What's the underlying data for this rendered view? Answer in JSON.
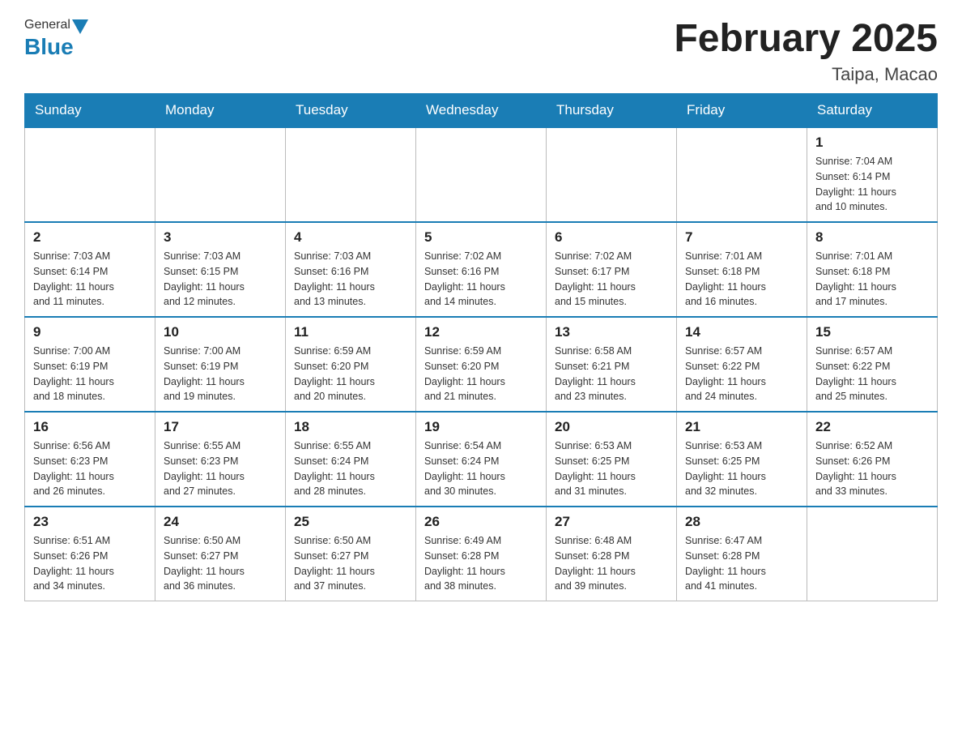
{
  "header": {
    "logo_general": "General",
    "logo_blue": "Blue",
    "main_title": "February 2025",
    "subtitle": "Taipa, Macao"
  },
  "weekdays": [
    "Sunday",
    "Monday",
    "Tuesday",
    "Wednesday",
    "Thursday",
    "Friday",
    "Saturday"
  ],
  "weeks": [
    [
      {
        "day": "",
        "info": ""
      },
      {
        "day": "",
        "info": ""
      },
      {
        "day": "",
        "info": ""
      },
      {
        "day": "",
        "info": ""
      },
      {
        "day": "",
        "info": ""
      },
      {
        "day": "",
        "info": ""
      },
      {
        "day": "1",
        "info": "Sunrise: 7:04 AM\nSunset: 6:14 PM\nDaylight: 11 hours\nand 10 minutes."
      }
    ],
    [
      {
        "day": "2",
        "info": "Sunrise: 7:03 AM\nSunset: 6:14 PM\nDaylight: 11 hours\nand 11 minutes."
      },
      {
        "day": "3",
        "info": "Sunrise: 7:03 AM\nSunset: 6:15 PM\nDaylight: 11 hours\nand 12 minutes."
      },
      {
        "day": "4",
        "info": "Sunrise: 7:03 AM\nSunset: 6:16 PM\nDaylight: 11 hours\nand 13 minutes."
      },
      {
        "day": "5",
        "info": "Sunrise: 7:02 AM\nSunset: 6:16 PM\nDaylight: 11 hours\nand 14 minutes."
      },
      {
        "day": "6",
        "info": "Sunrise: 7:02 AM\nSunset: 6:17 PM\nDaylight: 11 hours\nand 15 minutes."
      },
      {
        "day": "7",
        "info": "Sunrise: 7:01 AM\nSunset: 6:18 PM\nDaylight: 11 hours\nand 16 minutes."
      },
      {
        "day": "8",
        "info": "Sunrise: 7:01 AM\nSunset: 6:18 PM\nDaylight: 11 hours\nand 17 minutes."
      }
    ],
    [
      {
        "day": "9",
        "info": "Sunrise: 7:00 AM\nSunset: 6:19 PM\nDaylight: 11 hours\nand 18 minutes."
      },
      {
        "day": "10",
        "info": "Sunrise: 7:00 AM\nSunset: 6:19 PM\nDaylight: 11 hours\nand 19 minutes."
      },
      {
        "day": "11",
        "info": "Sunrise: 6:59 AM\nSunset: 6:20 PM\nDaylight: 11 hours\nand 20 minutes."
      },
      {
        "day": "12",
        "info": "Sunrise: 6:59 AM\nSunset: 6:20 PM\nDaylight: 11 hours\nand 21 minutes."
      },
      {
        "day": "13",
        "info": "Sunrise: 6:58 AM\nSunset: 6:21 PM\nDaylight: 11 hours\nand 23 minutes."
      },
      {
        "day": "14",
        "info": "Sunrise: 6:57 AM\nSunset: 6:22 PM\nDaylight: 11 hours\nand 24 minutes."
      },
      {
        "day": "15",
        "info": "Sunrise: 6:57 AM\nSunset: 6:22 PM\nDaylight: 11 hours\nand 25 minutes."
      }
    ],
    [
      {
        "day": "16",
        "info": "Sunrise: 6:56 AM\nSunset: 6:23 PM\nDaylight: 11 hours\nand 26 minutes."
      },
      {
        "day": "17",
        "info": "Sunrise: 6:55 AM\nSunset: 6:23 PM\nDaylight: 11 hours\nand 27 minutes."
      },
      {
        "day": "18",
        "info": "Sunrise: 6:55 AM\nSunset: 6:24 PM\nDaylight: 11 hours\nand 28 minutes."
      },
      {
        "day": "19",
        "info": "Sunrise: 6:54 AM\nSunset: 6:24 PM\nDaylight: 11 hours\nand 30 minutes."
      },
      {
        "day": "20",
        "info": "Sunrise: 6:53 AM\nSunset: 6:25 PM\nDaylight: 11 hours\nand 31 minutes."
      },
      {
        "day": "21",
        "info": "Sunrise: 6:53 AM\nSunset: 6:25 PM\nDaylight: 11 hours\nand 32 minutes."
      },
      {
        "day": "22",
        "info": "Sunrise: 6:52 AM\nSunset: 6:26 PM\nDaylight: 11 hours\nand 33 minutes."
      }
    ],
    [
      {
        "day": "23",
        "info": "Sunrise: 6:51 AM\nSunset: 6:26 PM\nDaylight: 11 hours\nand 34 minutes."
      },
      {
        "day": "24",
        "info": "Sunrise: 6:50 AM\nSunset: 6:27 PM\nDaylight: 11 hours\nand 36 minutes."
      },
      {
        "day": "25",
        "info": "Sunrise: 6:50 AM\nSunset: 6:27 PM\nDaylight: 11 hours\nand 37 minutes."
      },
      {
        "day": "26",
        "info": "Sunrise: 6:49 AM\nSunset: 6:28 PM\nDaylight: 11 hours\nand 38 minutes."
      },
      {
        "day": "27",
        "info": "Sunrise: 6:48 AM\nSunset: 6:28 PM\nDaylight: 11 hours\nand 39 minutes."
      },
      {
        "day": "28",
        "info": "Sunrise: 6:47 AM\nSunset: 6:28 PM\nDaylight: 11 hours\nand 41 minutes."
      },
      {
        "day": "",
        "info": ""
      }
    ]
  ]
}
